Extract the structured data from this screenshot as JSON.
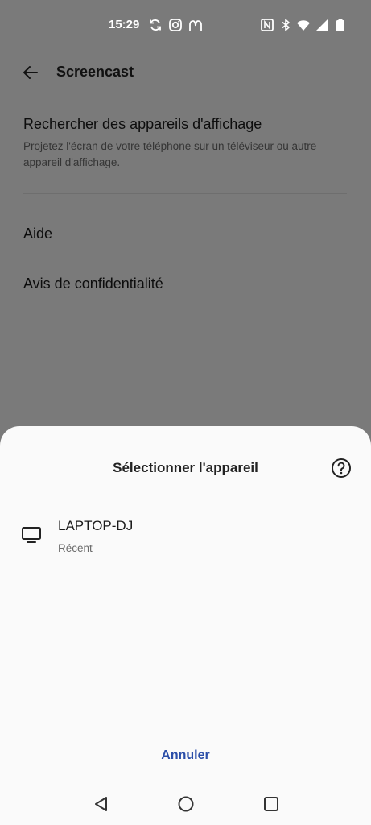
{
  "status_bar": {
    "time": "15:29",
    "left_icons": [
      "sync-icon",
      "instagram-icon",
      "mcdonalds-icon"
    ],
    "right_icons": [
      "nfc-icon",
      "bluetooth-icon",
      "wifi-icon",
      "signal-icon",
      "battery-icon"
    ]
  },
  "app_bar": {
    "title": "Screencast"
  },
  "settings": {
    "search_title": "Rechercher des appareils d'affichage",
    "search_subtitle": "Projetez l'écran de votre téléphone sur un téléviseur ou autre appareil d'affichage.",
    "help": "Aide",
    "privacy": "Avis de confidentialité"
  },
  "sheet": {
    "title": "Sélectionner l'appareil",
    "devices": [
      {
        "name": "LAPTOP-DJ",
        "status": "Récent",
        "icon": "monitor-icon"
      }
    ],
    "cancel_label": "Annuler"
  },
  "colors": {
    "accent": "#2b4ea8",
    "scrim": "#00000080",
    "sheet_bg": "#fafafa"
  }
}
